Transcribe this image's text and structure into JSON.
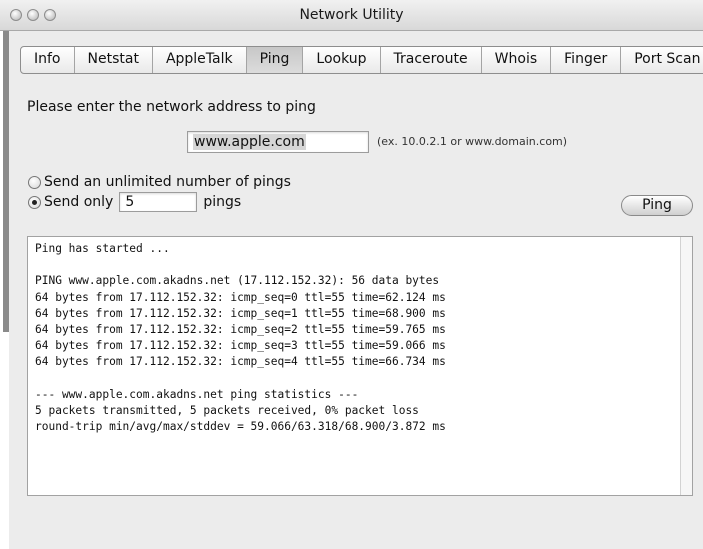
{
  "window": {
    "title": "Network Utility"
  },
  "tabs": [
    {
      "label": "Info",
      "active": false
    },
    {
      "label": "Netstat",
      "active": false
    },
    {
      "label": "AppleTalk",
      "active": false
    },
    {
      "label": "Ping",
      "active": true
    },
    {
      "label": "Lookup",
      "active": false
    },
    {
      "label": "Traceroute",
      "active": false
    },
    {
      "label": "Whois",
      "active": false
    },
    {
      "label": "Finger",
      "active": false
    },
    {
      "label": "Port Scan",
      "active": false
    }
  ],
  "ping": {
    "prompt": "Please enter the network address to ping",
    "address_value": "www.apple.com",
    "address_hint": "(ex. 10.0.2.1 or www.domain.com)",
    "unlimited_label": "Send an unlimited number of pings",
    "send_only_label": "Send only",
    "count_value": "5",
    "pings_suffix": "pings",
    "selected_option": "send_only",
    "ping_button": "Ping"
  },
  "output": {
    "lines": [
      "Ping has started ...",
      "",
      "PING www.apple.com.akadns.net (17.112.152.32): 56 data bytes",
      "64 bytes from 17.112.152.32: icmp_seq=0 ttl=55 time=62.124 ms",
      "64 bytes from 17.112.152.32: icmp_seq=1 ttl=55 time=68.900 ms",
      "64 bytes from 17.112.152.32: icmp_seq=2 ttl=55 time=59.765 ms",
      "64 bytes from 17.112.152.32: icmp_seq=3 ttl=55 time=59.066 ms",
      "64 bytes from 17.112.152.32: icmp_seq=4 ttl=55 time=66.734 ms",
      "",
      "--- www.apple.com.akadns.net ping statistics ---",
      "5 packets transmitted, 5 packets received, 0% packet loss",
      "round-trip min/avg/max/stddev = 59.066/63.318/68.900/3.872 ms"
    ]
  },
  "icons": {
    "close": "close-icon",
    "minimize": "minimize-icon",
    "zoom": "zoom-icon"
  }
}
